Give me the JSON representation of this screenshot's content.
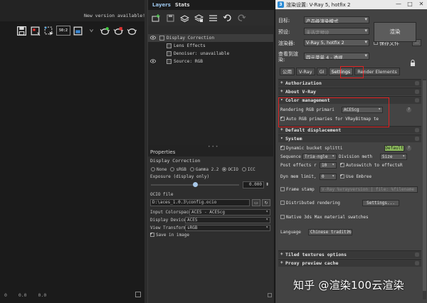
{
  "vfb": {
    "notice": "New version available!",
    "toolbar_icons": [
      "save-image-icon",
      "load-image-icon",
      "region-select-icon",
      "compare-50-icon",
      "frame-icon",
      "chevron-icon",
      "teapot-render-icon",
      "teapot-stop-icon",
      "teapot-icon"
    ],
    "compare_label": "50:2",
    "coords": [
      "0",
      "0.0",
      "0.0"
    ]
  },
  "layers": {
    "tabs": [
      "Layers",
      "Stats"
    ],
    "toolbar_icons": [
      "add-layer-icon",
      "save-layers-icon",
      "load-layers-icon",
      "layers-preset-icon",
      "list-icon",
      "undo-icon",
      "redo-icon"
    ],
    "tree": {
      "display_correction": "Display Correction",
      "lens_effects": "Lens Effects",
      "denoiser": "Denoiser: unavailable",
      "source": "Source: RGB"
    },
    "properties": {
      "title": "Properties",
      "subtitle": "Display Correction",
      "modes": [
        "None",
        "sRGB",
        "Gamma 2.2",
        "OCIO",
        "ICC"
      ],
      "selected_mode": "OCIO",
      "exposure_label": "Exposure (display only)",
      "exposure_value": "0.000",
      "exposure_fraction": 0.5,
      "ocio_label": "OCIO file",
      "ocio_path": "D:\\aces_1.0.3\\config.ocio",
      "input_label": "Input Colorspace",
      "input_value": "ACES - ACEScg",
      "display_label": "Display Device",
      "display_value": "ACES",
      "view_label": "View Transform",
      "view_value": "sRGB",
      "save_in_image": "Save in image"
    }
  },
  "render_setup": {
    "title": "渲染设置: V-Ray 5, hotfix 2",
    "window_buttons": [
      "—",
      "□",
      "✕"
    ],
    "target_label": "目标:",
    "target_value": "产品级渲染模式",
    "preset_label": "预设:",
    "preset_value": "未选定预设",
    "renderer_label": "渲染器:",
    "renderer_value": "V-Ray 5, hotfix 2",
    "save_file": "保存文件",
    "render_button": "渲染",
    "view_label": "查看到渲染:",
    "view_value": "四元菜单 4 - 透视",
    "tabs": [
      "公用",
      "V-Ray",
      "GI",
      "Settings",
      "Render Elements"
    ],
    "selected_tab": "Settings",
    "rollouts": {
      "authorization": "Authorization",
      "about": "About V-Ray",
      "color_mgmt": "Color management",
      "default_disp": "Default displacement",
      "system": "System",
      "tiled": "Tiled textures options",
      "proxy": "Proxy preview cache"
    },
    "color_mgmt": {
      "rgb_label": "Rendering RGB primari",
      "rgb_value": "ACEScg",
      "auto_label": "Auto RGB primaries for VRayBitmap te"
    },
    "system": {
      "dynamic_bucket": "Dynamic bucket splitti",
      "default_btn": "Default",
      "sequence_label": "Sequence",
      "sequence_value": "Tria-ngle",
      "division_label": "Division meth",
      "division_value": "Size",
      "post_label": "Post effects r",
      "post_value": "10",
      "autoswitch": "Autoswitch to effectsR",
      "dyn_mem_label": "Dyn mem limit,",
      "dyn_mem_value": "0",
      "embree": "Use Embree",
      "frame_stamp": "Frame stamp",
      "frame_stamp_value": "V-Ray %vrayversion | file: %filename",
      "distributed": "Distributed rendering",
      "dist_settings": "Settings...",
      "native_mat": "Native 3ds Max material swatches",
      "language_label": "Language",
      "language_value": "Chinese traditional"
    }
  },
  "watermark": "知乎 @渲染100云渲染",
  "colors": {
    "highlight": "#e02020",
    "default_btn": "#8fbf5e",
    "panel": "#434343"
  }
}
